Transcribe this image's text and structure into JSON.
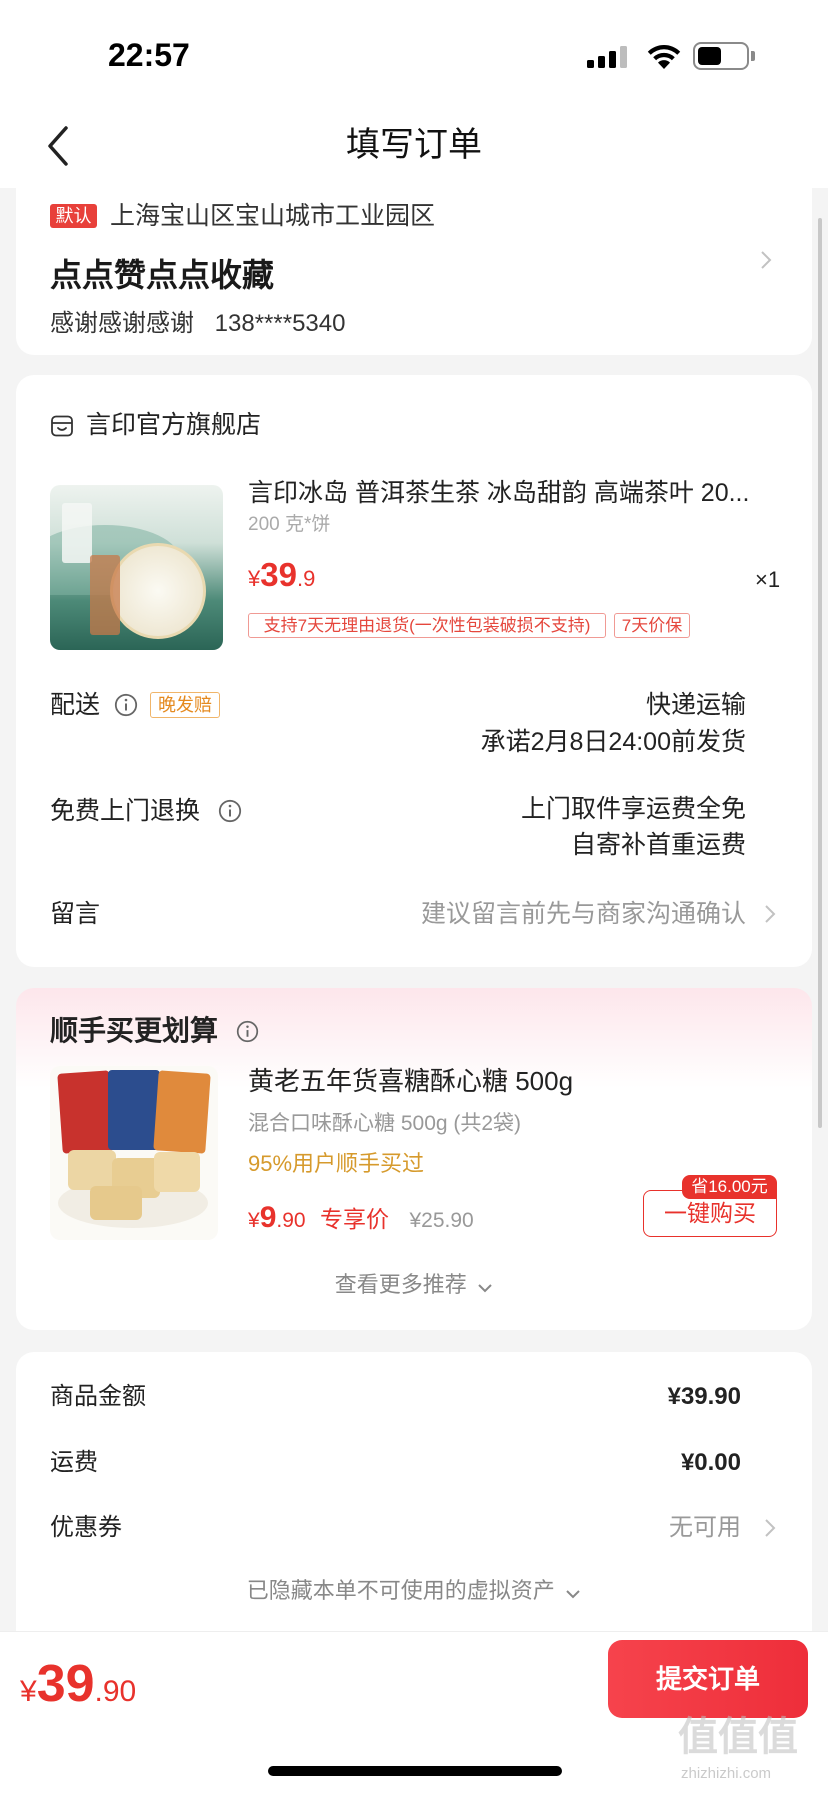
{
  "status_bar": {
    "time": "22:57",
    "signal_bars": 3,
    "signal_bars_total": 4,
    "battery_level": 0.5
  },
  "nav": {
    "title": "填写订单"
  },
  "address": {
    "default_badge": "默认",
    "region": "上海宝山区宝山城市工业园区",
    "detail": "点点赞点点收藏",
    "name": "感谢感谢感谢",
    "phone": "138****5340"
  },
  "store": {
    "name": "言印官方旗舰店"
  },
  "product": {
    "title": "言印冰岛 普洱茶生茶 冰岛甜韵 高端茶叶 20...",
    "spec": "200 克*饼",
    "price": {
      "symbol": "¥",
      "integer": "39",
      "decimal": ".9"
    },
    "quantity": "×1",
    "tags": [
      "支持7天无理由退货(一次性包装破损不支持)",
      "7天价保"
    ]
  },
  "delivery": {
    "label": "配送",
    "tag": "晚发赔",
    "method": "快递运输",
    "promise": "承诺2月8日24:00前发货"
  },
  "free_return": {
    "label": "免费上门退换",
    "line1": "上门取件享运费全免",
    "line2": "自寄补首重运费"
  },
  "message": {
    "label": "留言",
    "placeholder": "建议留言前先与商家沟通确认"
  },
  "recommend": {
    "title": "顺手买更划算",
    "item": {
      "title": "黄老五年货喜糖酥心糖 500g",
      "spec": "混合口味酥心糖 500g (共2袋)",
      "social_proof": "95%用户顺手买过",
      "price": {
        "symbol": "¥",
        "integer": "9",
        "decimal": ".90"
      },
      "price_label": "专享价",
      "original_price": "¥25.90",
      "save_badge": "省16.00元",
      "buy_button": "一键购买"
    },
    "more": "查看更多推荐"
  },
  "summary": {
    "rows": [
      {
        "label": "商品金额",
        "value": "¥39.90"
      },
      {
        "label": "运费",
        "value": "¥0.00"
      },
      {
        "label": "优惠券",
        "value": "无可用"
      }
    ],
    "hidden_assets": "已隐藏本单不可使用的虚拟资产"
  },
  "footer": {
    "total": {
      "symbol": "¥",
      "integer": "39",
      "decimal": ".90"
    },
    "submit_button": "提交订单"
  },
  "watermark": {
    "mark": "值值值",
    "site": "zhizhizhi.com"
  },
  "colors": {
    "accent": "#f2353f",
    "price": "#e8322c",
    "badge": "#e8403a",
    "orange_tag": "#e58a1f",
    "social_proof": "#d69a2c",
    "background": "#f4f4f4"
  },
  "icons": [
    "back-chevron-icon",
    "signal-icon",
    "wifi-icon",
    "battery-icon",
    "store-icon",
    "info-icon",
    "chevron-right-icon",
    "chevron-down-icon"
  ]
}
